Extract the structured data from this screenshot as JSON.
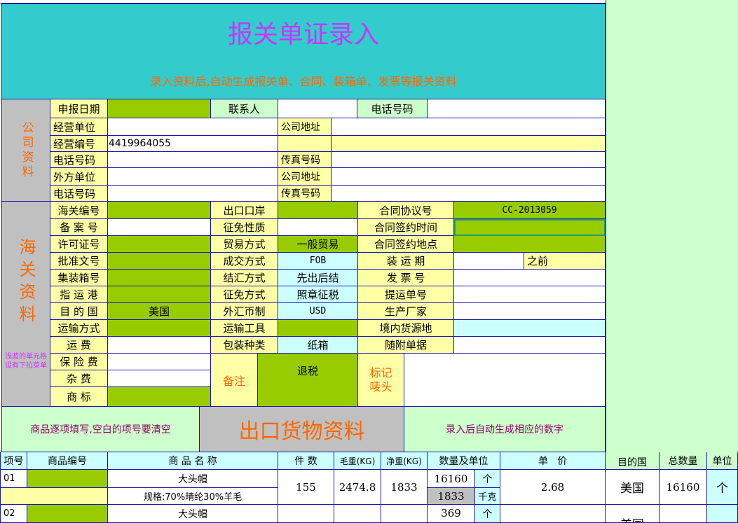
{
  "banner": {
    "title": "报关单证录入",
    "subtitle": "录入资料后,自动生成报关单、合同、装箱单、发票等报关资料"
  },
  "company": {
    "section_label": "公司资料",
    "declare_date_label": "申报日期",
    "contact_label": "联系人",
    "phone_label": "电话号码",
    "operator_label": "经营单位",
    "company_addr_label": "公司地址",
    "operator_code_label": "经营编号",
    "operator_code_value": "4419964055",
    "phone2_label": "电话号码",
    "fax_label": "传真号码",
    "foreign_unit_label": "外方单位",
    "company_addr2_label": "公司地址",
    "phone3_label": "电话号码",
    "fax2_label": "传真号码"
  },
  "customs": {
    "section_label": "海关资料",
    "side_note": "浅蓝的单元格设有下拉菜单",
    "rows": [
      {
        "l1": "海关编号",
        "v1": "",
        "l2": "出口口岸",
        "v2": "",
        "l3": "合同协议号",
        "v3": "CC-2013059"
      },
      {
        "l1": "备 案 号",
        "v1": "",
        "l2": "征免性质",
        "v2": "",
        "l3": "合同签约时间",
        "v3": ""
      },
      {
        "l1": "许可证号",
        "v1": "",
        "l2": "贸易方式",
        "v2": "一般贸易",
        "l3": "合同签约地点",
        "v3": ""
      },
      {
        "l1": "批准文号",
        "v1": "",
        "l2": "成交方式",
        "v2": "FOB",
        "l3": "装 运 期",
        "v3": "",
        "v3b": "之前"
      },
      {
        "l1": "集装箱号",
        "v1": "",
        "l2": "结汇方式",
        "v2": "先出后结",
        "l3": "发 票 号",
        "v3": ""
      },
      {
        "l1": "指 运 港",
        "v1": "",
        "l2": "征免方式",
        "v2": "照章征税",
        "l3": "提运单号",
        "v3": ""
      },
      {
        "l1": "目 的 国",
        "v1": "美国",
        "l2": "外汇币制",
        "v2": "USD",
        "l3": "生产厂家",
        "v3": ""
      },
      {
        "l1": "运输方式",
        "v1": "",
        "l2": "运输工具",
        "v2": "",
        "l3": "境内货源地",
        "v3": ""
      },
      {
        "l1": "运 费",
        "v1": "",
        "l2": "包装种类",
        "v2": "纸箱",
        "l3": "随附单据",
        "v3": ""
      }
    ],
    "insurance_label": "保 险 费",
    "misc_label": "杂 费",
    "brand_label": "商 标",
    "remark_label": "备注",
    "remark_value": "退税",
    "mark_label": "标记唛头"
  },
  "goods_header": {
    "left_note": "商品逐项填写,空白的项号要清空",
    "title": "出口货物资料",
    "right_note": "录入后自动生成相应的数字"
  },
  "table": {
    "headers": {
      "item_no": "项号",
      "code": "商品编号",
      "name": "商 品 名 称",
      "pieces": "件 数",
      "gross": "毛重(KG)",
      "net": "净重(KG)",
      "qty_unit": "数量及单位",
      "price": "单   价",
      "dest": "目的国",
      "total_qty": "总数量",
      "unit": "单位"
    },
    "rows": [
      {
        "item_no": "01",
        "name": "大头帽",
        "spec": "规格:70%晴纶30%羊毛",
        "pieces": "155",
        "gross": "2474.8",
        "net": "1833",
        "qty1": "16160",
        "unit1": "个",
        "qty2": "1833",
        "unit2": "千克",
        "price": "2.68",
        "dest": "美国",
        "total_qty": "16160",
        "unit": "个"
      },
      {
        "item_no": "02",
        "name": "大头帽",
        "qty1": "369",
        "unit1": "个",
        "dest": "美国"
      }
    ]
  },
  "colors": {
    "teal": "#33cccc",
    "yellow": "#ffffa6",
    "green": "#99cc00",
    "light_cyan": "#ccffff",
    "gray": "#c0c0c0",
    "light_green": "#ccffcc",
    "title_magenta": "#cc33ff",
    "orange": "#ff6600",
    "grid": "#1a1aa8"
  }
}
